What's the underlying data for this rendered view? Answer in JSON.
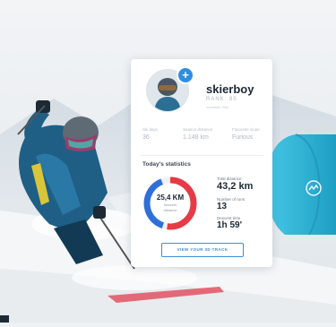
{
  "profile": {
    "username": "skierboy",
    "rank": "RANK: 85",
    "subtitle": "mountain rider",
    "add_button": "+"
  },
  "summary": [
    {
      "label": "Ski days",
      "value": "36"
    },
    {
      "label": "Season distance",
      "value": "1.148 km"
    },
    {
      "label": "Favourite slope",
      "value": "Furious"
    }
  ],
  "stats": {
    "title": "Today's statistics",
    "donut_value": "25,4 KM",
    "donut_label_1": "Descent",
    "donut_label_2": "distance",
    "donut_segments": [
      {
        "color": "#e63a46",
        "fraction": 0.55
      },
      {
        "color": "#2f6fd8",
        "fraction": 0.42
      }
    ],
    "total_distance_label": "Total distance",
    "total_distance_value": "43,2 km",
    "runs_label": "Number of runs",
    "runs_value": "13",
    "descent_time_label": "Descent time",
    "descent_time_value": "1h 59'"
  },
  "cta": {
    "label": "VIEW YOUR 3D TRACK"
  },
  "colors": {
    "accent": "#2e8fe0",
    "band": "#2bb3d6",
    "jacket": "#1f5f86"
  },
  "icons": {
    "wristband_logo": "wave-logo-icon",
    "plus": "plus-icon"
  }
}
